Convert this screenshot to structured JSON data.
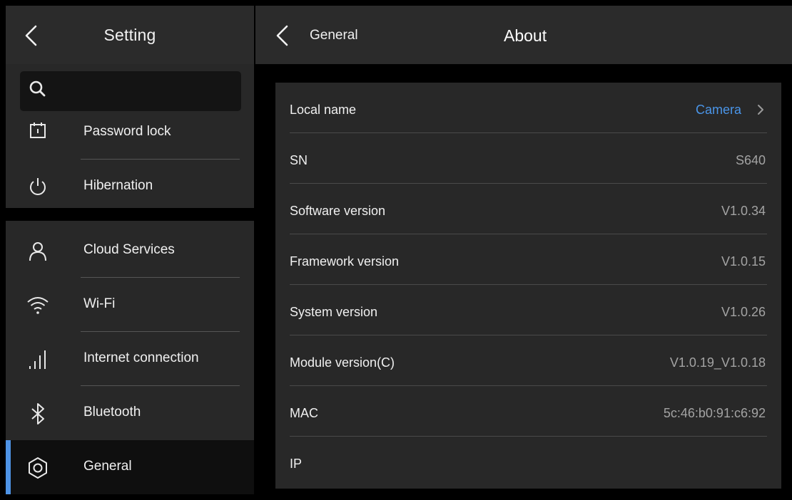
{
  "left": {
    "title": "Setting",
    "search": {
      "placeholder": "",
      "value": ""
    },
    "group1": [
      {
        "label": "Password lock",
        "icon": "password-lock-icon"
      },
      {
        "label": "Hibernation",
        "icon": "power-icon"
      }
    ],
    "group2": [
      {
        "label": "Cloud Services",
        "icon": "user-icon"
      },
      {
        "label": "Wi-Fi",
        "icon": "wifi-icon"
      },
      {
        "label": "Internet connection",
        "icon": "signal-bars-icon"
      },
      {
        "label": "Bluetooth",
        "icon": "bluetooth-icon"
      },
      {
        "label": "General",
        "icon": "gear-icon",
        "selected": true
      }
    ]
  },
  "right": {
    "breadcrumb": "General",
    "title": "About",
    "rows": [
      {
        "key": "Local name",
        "value": "Camera",
        "link": true
      },
      {
        "key": "SN",
        "value": "S640"
      },
      {
        "key": "Software version",
        "value": "V1.0.34"
      },
      {
        "key": "Framework version",
        "value": "V1.0.15"
      },
      {
        "key": "System version",
        "value": "V1.0.26"
      },
      {
        "key": "Module version(C)",
        "value": "V1.0.19_V1.0.18"
      },
      {
        "key": "MAC",
        "value": "5c:46:b0:91:c6:92"
      },
      {
        "key": "IP",
        "value": ""
      }
    ]
  },
  "colors": {
    "accent": "#4e93e6",
    "link": "#4a95e8",
    "panel": "#282828",
    "header": "#2b2b2b",
    "selected_row": "#0f0f0f",
    "background": "#000000"
  }
}
